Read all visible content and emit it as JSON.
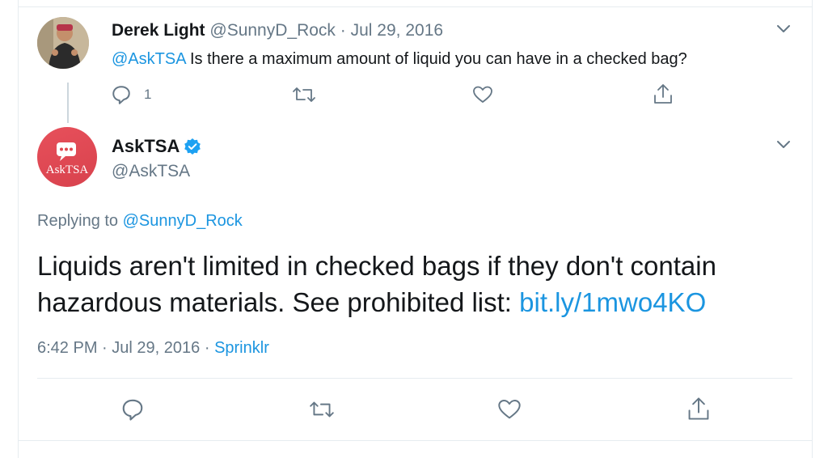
{
  "reply_tweet": {
    "author_name": "Derek Light",
    "author_handle": "@SunnyD_Rock",
    "separator": "·",
    "date": "Jul 29, 2016",
    "mention": "@AskTSA",
    "text": " Is there a maximum amount of liquid you can have in a checked bag?",
    "reply_count": "1"
  },
  "main_tweet": {
    "author_name": "AskTSA",
    "author_handle": "@AskTSA",
    "avatar_label": "AskTSA",
    "replying_to_label": "Replying to ",
    "replying_to_handle": "@SunnyD_Rock",
    "text": "Liquids aren't limited in checked bags if they don't contain hazardous materials. See prohibited list: ",
    "link": "bit.ly/1mwo4KO",
    "time": "6:42 PM",
    "separator": "·",
    "date": "Jul 29, 2016",
    "separator2": "·",
    "source": "Sprinklr"
  },
  "icons": {
    "reply": "reply-icon",
    "retweet": "retweet-icon",
    "like": "heart-icon",
    "share": "share-icon",
    "caret": "chevron-down-icon",
    "verified": "verified-badge-icon"
  },
  "colors": {
    "link": "#1b95e0",
    "muted": "#657786",
    "verified": "#1da1f2",
    "tsa_avatar": "#e0474f"
  }
}
